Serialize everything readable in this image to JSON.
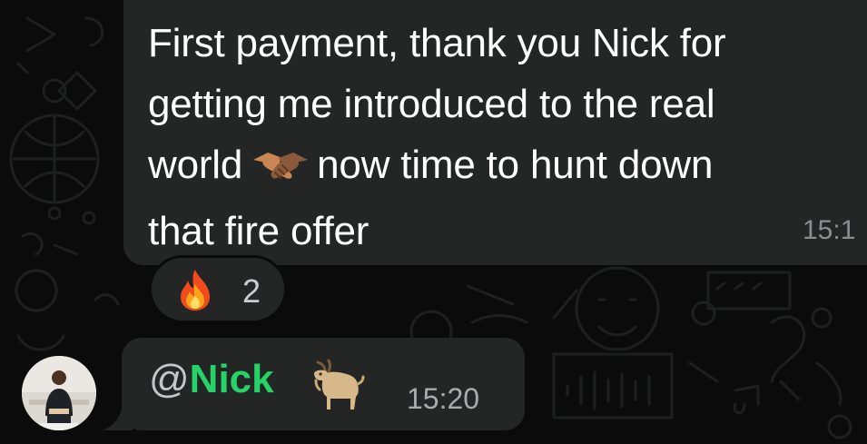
{
  "chat": {
    "message_top": {
      "lines": [
        "First payment, thank you Nick for",
        "getting me introduced to the real",
        "world",
        "now time to hunt down",
        "that fire offer"
      ],
      "emoji": "handshake-icon",
      "time": "15:1"
    },
    "reaction": {
      "emoji": "fire-icon",
      "count": "2"
    },
    "message_bottom": {
      "at": "@",
      "mention": "Nick",
      "emoji": "goat-icon",
      "time": "15:20"
    },
    "sender_avatar": "avatar"
  },
  "colors": {
    "background": "#0b0b0b",
    "bubble": "#242626",
    "mention": "#25d366",
    "timestamp": "#8a8f92"
  }
}
